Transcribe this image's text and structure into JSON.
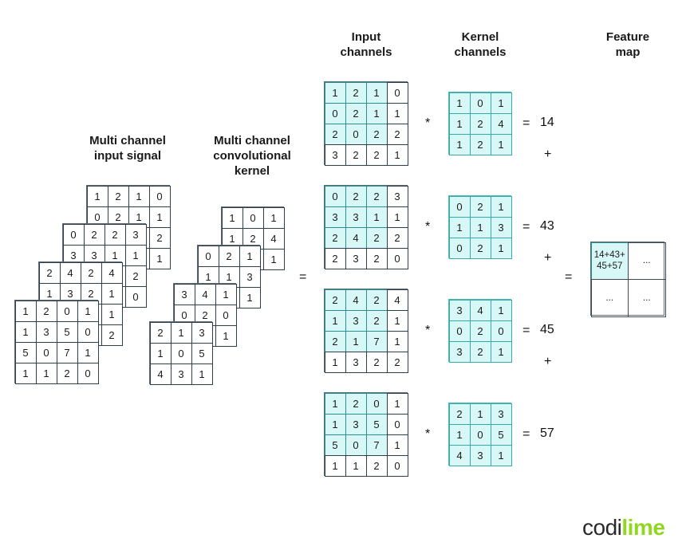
{
  "headings": {
    "input_signal": "Multi channel\ninput signal",
    "conv_kernel": "Multi channel\nconvolutional\nkernel",
    "input_channels": "Input\nchannels",
    "kernel_channels": "Kernel\nchannels",
    "feature_map": "Feature\nmap"
  },
  "input_layers": [
    [
      [
        "1",
        "2",
        "0",
        "1"
      ],
      [
        "1",
        "3",
        "5",
        "0"
      ],
      [
        "5",
        "0",
        "7",
        "1"
      ],
      [
        "1",
        "1",
        "2",
        "0"
      ]
    ],
    [
      [
        "2",
        "4",
        "2",
        "4"
      ],
      [
        "1",
        "3",
        "2",
        "1"
      ],
      [
        "2",
        "1",
        "7",
        "1"
      ],
      [
        "1",
        "3",
        "2",
        "2"
      ]
    ],
    [
      [
        "0",
        "2",
        "2",
        "3"
      ],
      [
        "3",
        "3",
        "1",
        "1"
      ],
      [
        "2",
        "4",
        "2",
        "2"
      ],
      [
        "2",
        "3",
        "2",
        "0"
      ]
    ],
    [
      [
        "1",
        "2",
        "1",
        "0"
      ],
      [
        "0",
        "2",
        "1",
        "1"
      ],
      [
        "2",
        "0",
        "2",
        "2"
      ],
      [
        "3",
        "2",
        "2",
        "1"
      ]
    ]
  ],
  "kernel_layers": [
    [
      [
        "2",
        "1",
        "3"
      ],
      [
        "1",
        "0",
        "5"
      ],
      [
        "4",
        "3",
        "1"
      ]
    ],
    [
      [
        "3",
        "4",
        "1"
      ],
      [
        "0",
        "2",
        "0"
      ],
      [
        "3",
        "2",
        "1"
      ]
    ],
    [
      [
        "0",
        "2",
        "1"
      ],
      [
        "1",
        "1",
        "3"
      ],
      [
        "0",
        "2",
        "1"
      ]
    ],
    [
      [
        "1",
        "0",
        "1"
      ],
      [
        "1",
        "2",
        "4"
      ],
      [
        "1",
        "2",
        "1"
      ]
    ]
  ],
  "channels": [
    {
      "input": [
        [
          "1",
          "2",
          "1",
          "0"
        ],
        [
          "0",
          "2",
          "1",
          "1"
        ],
        [
          "2",
          "0",
          "2",
          "2"
        ],
        [
          "3",
          "2",
          "2",
          "1"
        ]
      ],
      "kernel": [
        [
          "1",
          "0",
          "1"
        ],
        [
          "1",
          "2",
          "4"
        ],
        [
          "1",
          "2",
          "1"
        ]
      ],
      "result": "14",
      "plus": "+"
    },
    {
      "input": [
        [
          "0",
          "2",
          "2",
          "3"
        ],
        [
          "3",
          "3",
          "1",
          "1"
        ],
        [
          "2",
          "4",
          "2",
          "2"
        ],
        [
          "2",
          "3",
          "2",
          "0"
        ]
      ],
      "kernel": [
        [
          "0",
          "2",
          "1"
        ],
        [
          "1",
          "1",
          "3"
        ],
        [
          "0",
          "2",
          "1"
        ]
      ],
      "result": "43",
      "plus": "+"
    },
    {
      "input": [
        [
          "2",
          "4",
          "2",
          "4"
        ],
        [
          "1",
          "3",
          "2",
          "1"
        ],
        [
          "2",
          "1",
          "7",
          "1"
        ],
        [
          "1",
          "3",
          "2",
          "2"
        ]
      ],
      "kernel": [
        [
          "3",
          "4",
          "1"
        ],
        [
          "0",
          "2",
          "0"
        ],
        [
          "3",
          "2",
          "1"
        ]
      ],
      "result": "45",
      "plus": "+"
    },
    {
      "input": [
        [
          "1",
          "2",
          "0",
          "1"
        ],
        [
          "1",
          "3",
          "5",
          "0"
        ],
        [
          "5",
          "0",
          "7",
          "1"
        ],
        [
          "1",
          "1",
          "2",
          "0"
        ]
      ],
      "kernel": [
        [
          "2",
          "1",
          "3"
        ],
        [
          "1",
          "0",
          "5"
        ],
        [
          "4",
          "3",
          "1"
        ]
      ],
      "result": "57",
      "plus": ""
    }
  ],
  "operators": {
    "conv": "*",
    "equals": "="
  },
  "feature_map": {
    "cells": [
      "14+43+\n45+57",
      "...",
      "...",
      "..."
    ]
  },
  "logo": {
    "part1": "codi",
    "part2": "lime"
  },
  "colors": {
    "highlight": "#d8f8f8",
    "highlight_border": "#2c8f8f",
    "grid_border": "#2f3e4b",
    "logo_green": "#8fd81e"
  }
}
